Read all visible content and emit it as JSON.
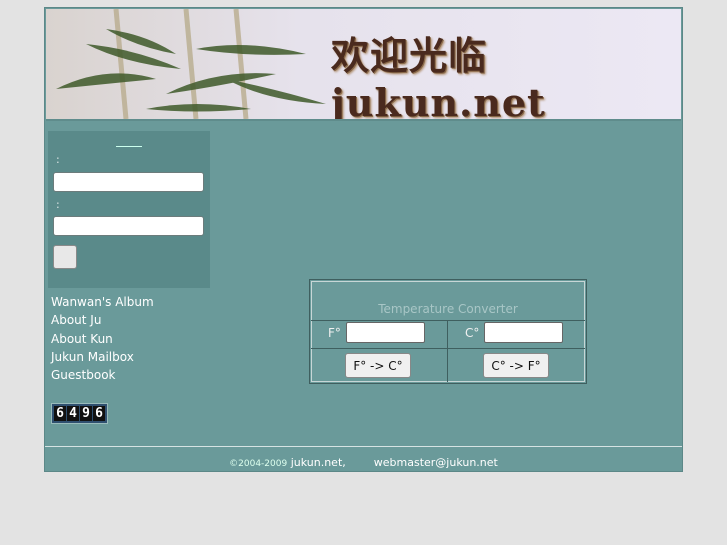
{
  "banner": {
    "title": "欢迎光临 jukun.net"
  },
  "login": {
    "title": "",
    "user_label": ":",
    "pass_label": ":"
  },
  "nav": {
    "items": [
      {
        "label": "Wanwan's Album"
      },
      {
        "label": "About Ju"
      },
      {
        "label": "About Kun"
      },
      {
        "label": "Jukun Mailbox"
      },
      {
        "label": "Guestbook"
      }
    ]
  },
  "counter": {
    "digits": [
      "6",
      "4",
      "9",
      "6"
    ]
  },
  "converter": {
    "title": "Temperature Converter",
    "f_label": "F°",
    "c_label": "C°",
    "f_to_c_button": "F° -> C°",
    "c_to_f_button": "C° -> F°"
  },
  "footer": {
    "copyright": "©2004-2009",
    "site": "jukun.net",
    "separator": ",",
    "email": "webmaster@jukun.net"
  },
  "colors": {
    "page_bg": "#e3e3e3",
    "content_bg": "#6a9a9a",
    "sidebar_box": "#5a8a8a"
  }
}
